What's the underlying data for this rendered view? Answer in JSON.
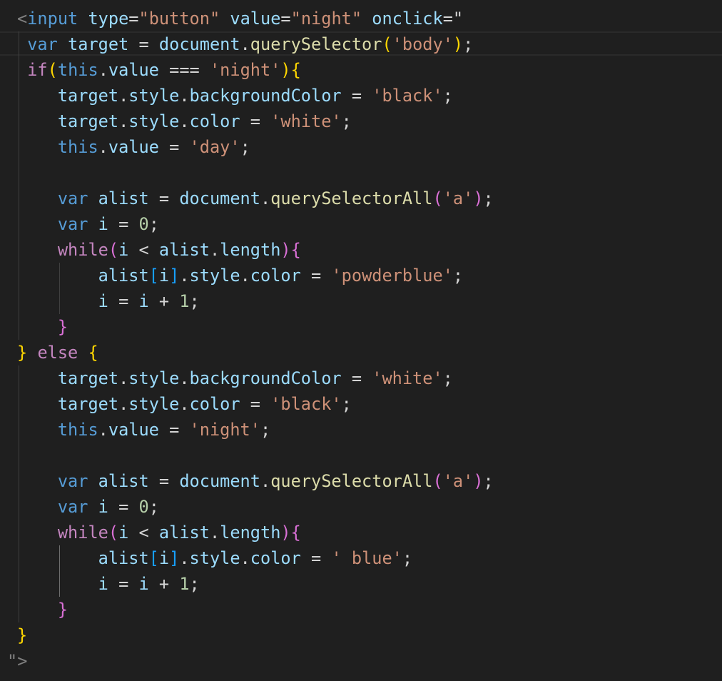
{
  "editor": {
    "background": "#1f1f1f",
    "lines": [
      [
        {
          "t": "<",
          "c": "angle"
        },
        {
          "t": "input",
          "c": "tag"
        },
        {
          "t": " "
        },
        {
          "t": "type",
          "c": "attr"
        },
        {
          "t": "=",
          "c": "punc"
        },
        {
          "t": "\"button\"",
          "c": "str"
        },
        {
          "t": " "
        },
        {
          "t": "value",
          "c": "attr"
        },
        {
          "t": "=",
          "c": "punc"
        },
        {
          "t": "\"night\"",
          "c": "str"
        },
        {
          "t": " "
        },
        {
          "t": "onclick",
          "c": "attr"
        },
        {
          "t": "=\"",
          "c": "punc"
        }
      ],
      [
        {
          "t": " "
        },
        {
          "t": "var",
          "c": "kw"
        },
        {
          "t": " "
        },
        {
          "t": "target",
          "c": "var"
        },
        {
          "t": " = "
        },
        {
          "t": "document",
          "c": "var"
        },
        {
          "t": "."
        },
        {
          "t": "querySelector",
          "c": "fn"
        },
        {
          "t": "(",
          "c": "b1"
        },
        {
          "t": "'body'",
          "c": "str"
        },
        {
          "t": ")",
          "c": "b1"
        },
        {
          "t": ";"
        }
      ],
      [
        {
          "t": " "
        },
        {
          "t": "if",
          "c": "ctrl"
        },
        {
          "t": "(",
          "c": "b1"
        },
        {
          "t": "this",
          "c": "kw"
        },
        {
          "t": "."
        },
        {
          "t": "value",
          "c": "var"
        },
        {
          "t": " === "
        },
        {
          "t": "'night'",
          "c": "str"
        },
        {
          "t": ")",
          "c": "b1"
        },
        {
          "t": "{",
          "c": "b1"
        }
      ],
      [
        {
          "t": "    "
        },
        {
          "t": "target",
          "c": "var"
        },
        {
          "t": "."
        },
        {
          "t": "style",
          "c": "var"
        },
        {
          "t": "."
        },
        {
          "t": "backgroundColor",
          "c": "var"
        },
        {
          "t": " = "
        },
        {
          "t": "'black'",
          "c": "str"
        },
        {
          "t": ";"
        }
      ],
      [
        {
          "t": "    "
        },
        {
          "t": "target",
          "c": "var"
        },
        {
          "t": "."
        },
        {
          "t": "style",
          "c": "var"
        },
        {
          "t": "."
        },
        {
          "t": "color",
          "c": "var"
        },
        {
          "t": " = "
        },
        {
          "t": "'white'",
          "c": "str"
        },
        {
          "t": ";"
        }
      ],
      [
        {
          "t": "    "
        },
        {
          "t": "this",
          "c": "kw"
        },
        {
          "t": "."
        },
        {
          "t": "value",
          "c": "var"
        },
        {
          "t": " = "
        },
        {
          "t": "'day'",
          "c": "str"
        },
        {
          "t": ";"
        }
      ],
      [],
      [
        {
          "t": "    "
        },
        {
          "t": "var",
          "c": "kw"
        },
        {
          "t": " "
        },
        {
          "t": "alist",
          "c": "var"
        },
        {
          "t": " = "
        },
        {
          "t": "document",
          "c": "var"
        },
        {
          "t": "."
        },
        {
          "t": "querySelectorAll",
          "c": "fn"
        },
        {
          "t": "(",
          "c": "b2"
        },
        {
          "t": "'a'",
          "c": "str"
        },
        {
          "t": ")",
          "c": "b2"
        },
        {
          "t": ";"
        }
      ],
      [
        {
          "t": "    "
        },
        {
          "t": "var",
          "c": "kw"
        },
        {
          "t": " "
        },
        {
          "t": "i",
          "c": "var"
        },
        {
          "t": " = "
        },
        {
          "t": "0",
          "c": "num"
        },
        {
          "t": ";"
        }
      ],
      [
        {
          "t": "    "
        },
        {
          "t": "while",
          "c": "ctrl"
        },
        {
          "t": "(",
          "c": "b2"
        },
        {
          "t": "i",
          "c": "var"
        },
        {
          "t": " < "
        },
        {
          "t": "alist",
          "c": "var"
        },
        {
          "t": "."
        },
        {
          "t": "length",
          "c": "var"
        },
        {
          "t": ")",
          "c": "b2"
        },
        {
          "t": "{",
          "c": "b2"
        }
      ],
      [
        {
          "t": "        "
        },
        {
          "t": "alist",
          "c": "var"
        },
        {
          "t": "[",
          "c": "b3"
        },
        {
          "t": "i",
          "c": "var"
        },
        {
          "t": "]",
          "c": "b3"
        },
        {
          "t": "."
        },
        {
          "t": "style",
          "c": "var"
        },
        {
          "t": "."
        },
        {
          "t": "color",
          "c": "var"
        },
        {
          "t": " = "
        },
        {
          "t": "'powderblue'",
          "c": "str"
        },
        {
          "t": ";"
        }
      ],
      [
        {
          "t": "        "
        },
        {
          "t": "i",
          "c": "var"
        },
        {
          "t": " = "
        },
        {
          "t": "i",
          "c": "var"
        },
        {
          "t": " + "
        },
        {
          "t": "1",
          "c": "num"
        },
        {
          "t": ";"
        }
      ],
      [
        {
          "t": "    "
        },
        {
          "t": "}",
          "c": "b2"
        }
      ],
      [
        {
          "t": "}",
          "c": "b1"
        },
        {
          "t": " "
        },
        {
          "t": "else",
          "c": "ctrl"
        },
        {
          "t": " "
        },
        {
          "t": "{",
          "c": "b1"
        }
      ],
      [
        {
          "t": "    "
        },
        {
          "t": "target",
          "c": "var"
        },
        {
          "t": "."
        },
        {
          "t": "style",
          "c": "var"
        },
        {
          "t": "."
        },
        {
          "t": "backgroundColor",
          "c": "var"
        },
        {
          "t": " = "
        },
        {
          "t": "'white'",
          "c": "str"
        },
        {
          "t": ";"
        }
      ],
      [
        {
          "t": "    "
        },
        {
          "t": "target",
          "c": "var"
        },
        {
          "t": "."
        },
        {
          "t": "style",
          "c": "var"
        },
        {
          "t": "."
        },
        {
          "t": "color",
          "c": "var"
        },
        {
          "t": " = "
        },
        {
          "t": "'black'",
          "c": "str"
        },
        {
          "t": ";"
        }
      ],
      [
        {
          "t": "    "
        },
        {
          "t": "this",
          "c": "kw"
        },
        {
          "t": "."
        },
        {
          "t": "value",
          "c": "var"
        },
        {
          "t": " = "
        },
        {
          "t": "'night'",
          "c": "str"
        },
        {
          "t": ";"
        }
      ],
      [],
      [
        {
          "t": "    "
        },
        {
          "t": "var",
          "c": "kw"
        },
        {
          "t": " "
        },
        {
          "t": "alist",
          "c": "var"
        },
        {
          "t": " = "
        },
        {
          "t": "document",
          "c": "var"
        },
        {
          "t": "."
        },
        {
          "t": "querySelectorAll",
          "c": "fn"
        },
        {
          "t": "(",
          "c": "b2"
        },
        {
          "t": "'a'",
          "c": "str"
        },
        {
          "t": ")",
          "c": "b2"
        },
        {
          "t": ";"
        }
      ],
      [
        {
          "t": "    "
        },
        {
          "t": "var",
          "c": "kw"
        },
        {
          "t": " "
        },
        {
          "t": "i",
          "c": "var"
        },
        {
          "t": " = "
        },
        {
          "t": "0",
          "c": "num"
        },
        {
          "t": ";"
        }
      ],
      [
        {
          "t": "    "
        },
        {
          "t": "while",
          "c": "ctrl"
        },
        {
          "t": "(",
          "c": "b2"
        },
        {
          "t": "i",
          "c": "var"
        },
        {
          "t": " < "
        },
        {
          "t": "alist",
          "c": "var"
        },
        {
          "t": "."
        },
        {
          "t": "length",
          "c": "var"
        },
        {
          "t": ")",
          "c": "b2"
        },
        {
          "t": "{",
          "c": "b2"
        }
      ],
      [
        {
          "t": "        "
        },
        {
          "t": "alist",
          "c": "var"
        },
        {
          "t": "[",
          "c": "b3"
        },
        {
          "t": "i",
          "c": "var"
        },
        {
          "t": "]",
          "c": "b3"
        },
        {
          "t": "."
        },
        {
          "t": "style",
          "c": "var"
        },
        {
          "t": "."
        },
        {
          "t": "color",
          "c": "var"
        },
        {
          "t": " = "
        },
        {
          "t": "' blue'",
          "c": "str"
        },
        {
          "t": ";"
        }
      ],
      [
        {
          "t": "        "
        },
        {
          "t": "i",
          "c": "var"
        },
        {
          "t": " = "
        },
        {
          "t": "i",
          "c": "var"
        },
        {
          "t": " + "
        },
        {
          "t": "1",
          "c": "num"
        },
        {
          "t": ";"
        }
      ],
      [
        {
          "t": "    "
        },
        {
          "t": "}",
          "c": "b2"
        }
      ],
      [
        {
          "t": "}",
          "c": "b1"
        }
      ],
      [
        {
          "t": "\">",
          "c": "angle"
        }
      ]
    ]
  }
}
